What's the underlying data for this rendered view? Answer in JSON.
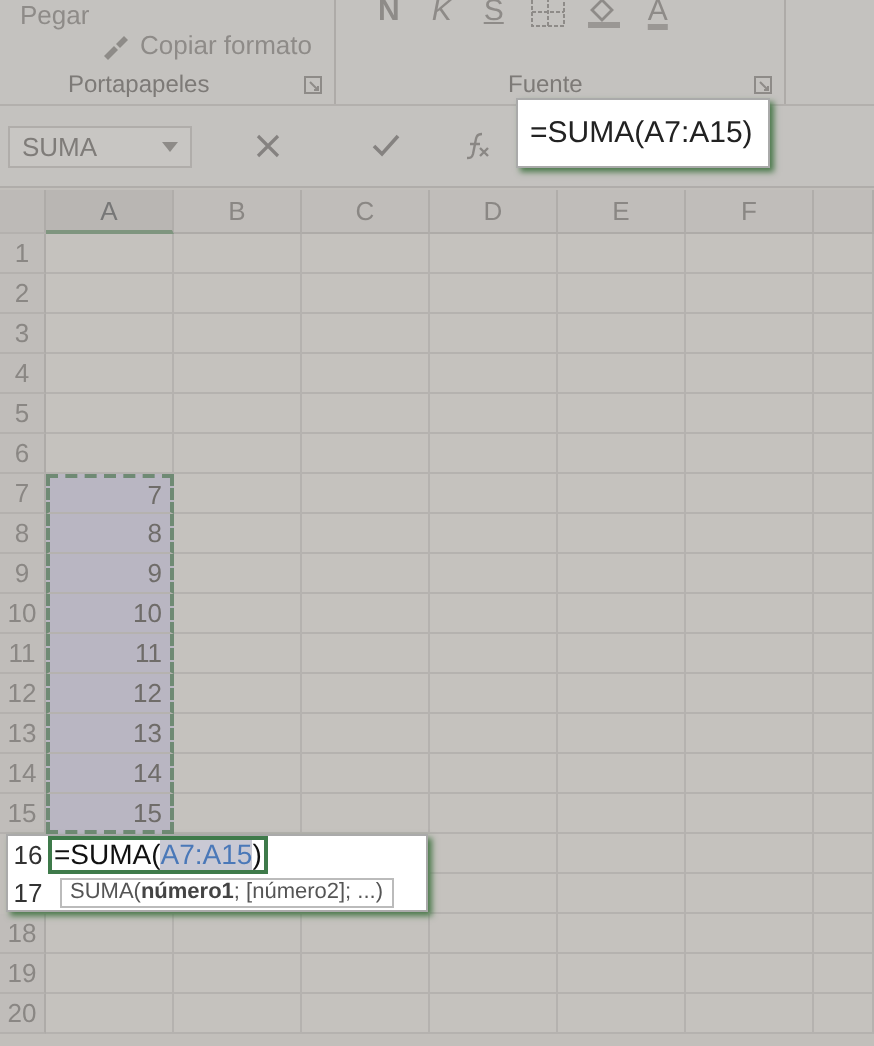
{
  "ribbon": {
    "groups": [
      {
        "label": "Portapapeles",
        "buttons": [
          {
            "label": "Pegar",
            "kind": "paste"
          },
          {
            "label": "Copiar formato",
            "kind": "brush"
          }
        ]
      },
      {
        "label": "Fuente",
        "buttons": [
          {
            "label": "N",
            "kind": "bold"
          },
          {
            "label": "K",
            "kind": "italic"
          },
          {
            "label": "S",
            "kind": "underline"
          },
          {
            "kind": "borders"
          },
          {
            "kind": "fill"
          },
          {
            "label": "A",
            "kind": "fontcolor"
          }
        ]
      }
    ]
  },
  "name_box": {
    "value": "SUMA"
  },
  "formula_bar": {
    "value": "=SUMA(A7:A15)"
  },
  "columns": [
    "A",
    "B",
    "C",
    "D",
    "E",
    "F"
  ],
  "rows": [
    {
      "number": "1",
      "in_range": false
    },
    {
      "number": "2",
      "in_range": false
    },
    {
      "number": "3",
      "in_range": false
    },
    {
      "number": "4",
      "in_range": false
    },
    {
      "number": "5",
      "in_range": false
    },
    {
      "number": "6",
      "in_range": false
    },
    {
      "number": "7",
      "value": "7",
      "in_range": true
    },
    {
      "number": "8",
      "value": "8",
      "in_range": true
    },
    {
      "number": "9",
      "value": "9",
      "in_range": true
    },
    {
      "number": "10",
      "value": "10",
      "in_range": true
    },
    {
      "number": "11",
      "value": "11",
      "in_range": true
    },
    {
      "number": "12",
      "value": "12",
      "in_range": true
    },
    {
      "number": "13",
      "value": "13",
      "in_range": true
    },
    {
      "number": "14",
      "value": "14",
      "in_range": true
    },
    {
      "number": "15",
      "value": "15",
      "in_range": true
    },
    {
      "number": "18",
      "in_range": false
    },
    {
      "number": "19",
      "in_range": false
    },
    {
      "number": "20",
      "in_range": false
    }
  ],
  "cell_editor": {
    "row_numbers": [
      "16",
      "17"
    ],
    "formula": [
      {
        "text": "=SUMA(",
        "kind": "plain"
      },
      {
        "text": "A7:A15",
        "kind": "reference"
      },
      {
        "text": ")",
        "kind": "plain"
      }
    ],
    "tooltip": "SUMA(**número1**; [número2]; ...)"
  }
}
